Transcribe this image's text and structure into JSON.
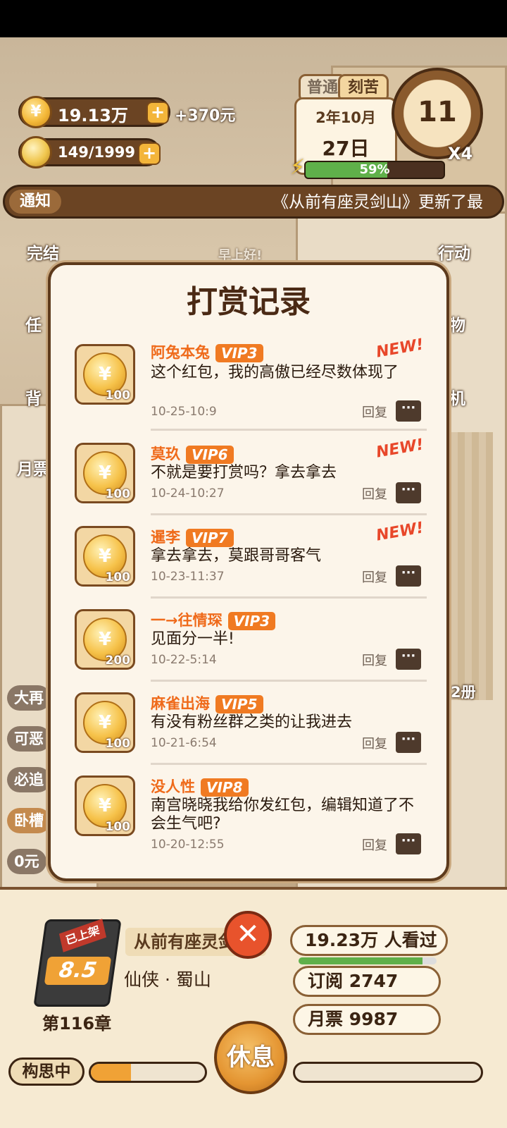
{
  "hud": {
    "coins": "19.13万",
    "coin_bonus": "+370元",
    "ideas": "149/1999",
    "plus": "+",
    "coin_symbol": "¥"
  },
  "calendar": {
    "tag_normal": "普通",
    "tag_hard": "刻苦",
    "month": "2年10月",
    "day": "27日",
    "hour": "11",
    "speed": "X4",
    "energy": "59%",
    "energy_value": 0.59
  },
  "notice": {
    "label": "通知",
    "text": "《从前有座灵剑山》更新了最"
  },
  "side_menu": {
    "finished": "完结",
    "task": "任",
    "bag": "背",
    "monthly": "月票",
    "action": "行动",
    "shop": "物",
    "phone": "机",
    "volumes": "2册",
    "greeting": "早上好!"
  },
  "side_chips": [
    "大再",
    "可恶",
    "必追",
    "卧槽",
    "0元"
  ],
  "modal": {
    "title": "打赏记录",
    "reply_label": "回复",
    "records": [
      {
        "name": "阿兔本兔",
        "vip": "VIP3",
        "new": "NEW!",
        "message": "这个红包，我的高傲已经尽数体现了",
        "time": "10-25-10:9",
        "amount": "100"
      },
      {
        "name": "莫玖",
        "vip": "VIP6",
        "new": "NEW!",
        "message": "不就是要打赏吗？拿去拿去",
        "time": "10-24-10:27",
        "amount": "100"
      },
      {
        "name": "暹李",
        "vip": "VIP7",
        "new": "NEW!",
        "message": "拿去拿去，莫跟哥哥客气",
        "time": "10-23-11:37",
        "amount": "100"
      },
      {
        "name": "一→往情琛",
        "vip": "VIP3",
        "new": "",
        "message": "见面分一半!",
        "time": "10-22-5:14",
        "amount": "200"
      },
      {
        "name": "麻雀出海",
        "vip": "VIP5",
        "new": "",
        "message": "有没有粉丝群之类的让我进去",
        "time": "10-21-6:54",
        "amount": "100"
      },
      {
        "name": "没人性",
        "vip": "VIP8",
        "new": "",
        "message": "南宫晓晓我给你发红包，编辑知道了不会生气吧?",
        "time": "10-20-12:55",
        "amount": "100"
      }
    ]
  },
  "book": {
    "badge": "已上架",
    "score": "8.5",
    "chapter": "第116章",
    "title": "从前有座灵剑山",
    "genre": "仙侠 · 蜀山",
    "views": "19.23万 人看过",
    "views_progress": 0.9,
    "subscriptions": "订阅 2747",
    "monthly_votes": "月票 9987"
  },
  "footer": {
    "idea_label": "构思中",
    "idea_progress": 0.35,
    "rest": "休息",
    "close_symbol": "✕"
  }
}
